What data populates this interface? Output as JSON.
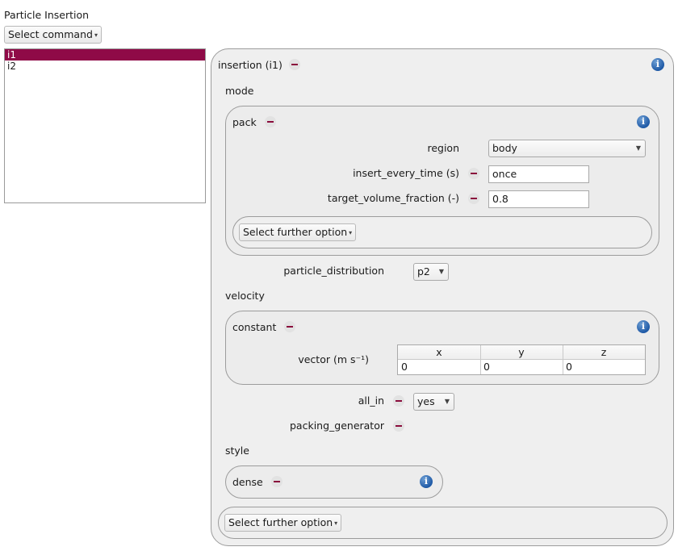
{
  "page": {
    "title": "Particle Insertion"
  },
  "command_select": {
    "label": "Select command"
  },
  "list": {
    "items": [
      {
        "label": "i1",
        "selected": true
      },
      {
        "label": "i2",
        "selected": false
      }
    ]
  },
  "insertion": {
    "title": "insertion (i1)",
    "mode_label": "mode",
    "pack": {
      "title": "pack",
      "region_label": "region",
      "region_value": "body",
      "insert_every_time_label": "insert_every_time (s)",
      "insert_every_time_value": "once",
      "target_volume_fraction_label": "target_volume_fraction (-)",
      "target_volume_fraction_value": "0.8",
      "further_option_label": "Select further option"
    },
    "particle_distribution_label": "particle_distribution",
    "particle_distribution_value": "p2",
    "velocity_label": "velocity",
    "constant": {
      "title": "constant",
      "vector_label": "vector (m s⁻¹)",
      "columns": [
        "x",
        "y",
        "z"
      ],
      "values": [
        "0",
        "0",
        "0"
      ]
    },
    "all_in_label": "all_in",
    "all_in_value": "yes",
    "packing_generator_label": "packing_generator",
    "style_label": "style",
    "dense": {
      "title": "dense"
    },
    "further_option_label": "Select further option"
  },
  "colors": {
    "selection": "#8f0a47",
    "minus": "#8a0c3c",
    "info": "#1f5aa6"
  }
}
